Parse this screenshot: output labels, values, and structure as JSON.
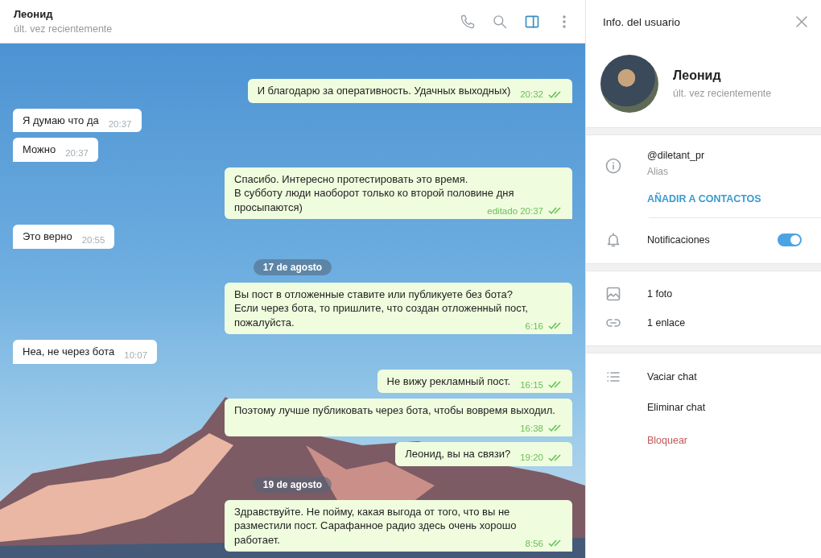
{
  "chat": {
    "title": "Леонид",
    "status": "últ. vez recientemente",
    "panel_toggle_active": true,
    "messages": [
      {
        "kind": "out",
        "text": "И благодарю за оперативность. Удачных выходных)",
        "time": "20:32",
        "read": true
      },
      {
        "kind": "in",
        "text": "Я думаю что да",
        "time": "20:37"
      },
      {
        "kind": "in",
        "text": "Можно",
        "time": "20:37"
      },
      {
        "kind": "out",
        "text": "Спасибо. Интересно протестировать это время.\nВ субботу люди наоборот только ко второй половине дня просыпаются)",
        "time": "editado 20:37",
        "read": true
      },
      {
        "kind": "in",
        "text": "Это верно",
        "time": "20:55"
      },
      {
        "kind": "date",
        "text": "17 de agosto"
      },
      {
        "kind": "out",
        "text": "Вы пост в отложенные ставите или публикуете без бота?\nЕсли через бота, то пришлите, что создан отложенный пост, пожалуйста.",
        "time": "6:16",
        "read": true
      },
      {
        "kind": "in",
        "text": "Неа, не через бота",
        "time": "10:07"
      },
      {
        "kind": "out",
        "text": "Не вижу рекламный пост.",
        "time": "16:15",
        "read": true
      },
      {
        "kind": "out",
        "text": "Поэтому лучше публиковать через бота, чтобы вовремя выходил.",
        "time": "16:38",
        "read": true
      },
      {
        "kind": "out",
        "text": "Леонид, вы на связи?",
        "time": "19:20",
        "read": true
      },
      {
        "kind": "date",
        "text": "19 de agosto"
      },
      {
        "kind": "out",
        "text": "Здравствуйте. Не пойму, какая выгода от того, что вы не разместили пост. Сарафанное радио здесь очень хорошо работает.",
        "time": "8:56",
        "read": true
      }
    ]
  },
  "info": {
    "title": "Info. del usuario",
    "name": "Леонид",
    "status": "últ. vez recientemente",
    "username": "@diletant_pr",
    "username_label": "Alias",
    "add_contact": "AÑADIR A CONTACTOS",
    "notifications": {
      "label": "Notificaciones",
      "on": true
    },
    "media": [
      {
        "kind": "photo",
        "label": "1 foto"
      },
      {
        "kind": "link",
        "label": "1 enlace"
      }
    ],
    "actions": [
      {
        "kind": "normal",
        "label": "Vaciar chat"
      },
      {
        "kind": "normal",
        "label": "Eliminar chat"
      },
      {
        "kind": "danger",
        "label": "Bloquear"
      }
    ]
  }
}
